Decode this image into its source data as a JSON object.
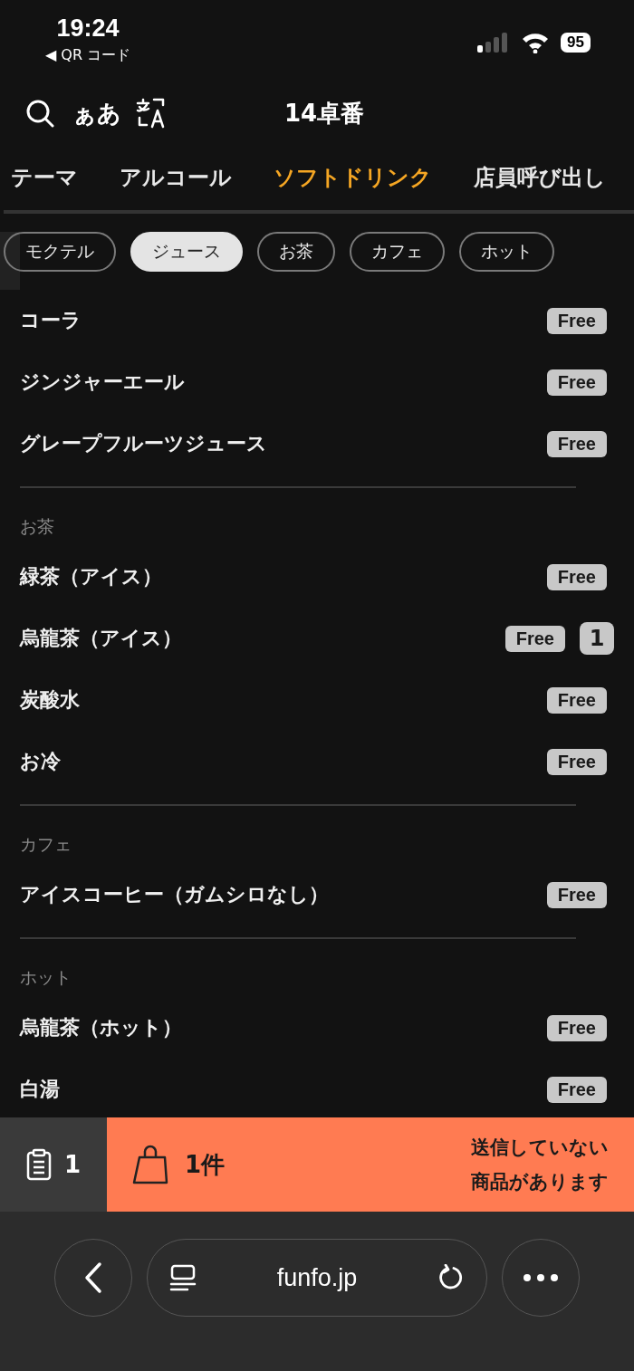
{
  "status_bar": {
    "time": "19:24",
    "back_link": "◀ QR コード",
    "battery": "95"
  },
  "header": {
    "text_size_button": "ぁあ",
    "title": "14卓番"
  },
  "tabs": [
    {
      "label": "テーマ",
      "selected": false
    },
    {
      "label": "アルコール",
      "selected": false
    },
    {
      "label": "ソフトドリンク",
      "selected": true
    },
    {
      "label": "店員呼び出し",
      "selected": false
    }
  ],
  "chips": [
    {
      "label": "モクテル",
      "selected": false
    },
    {
      "label": "ジュース",
      "selected": true
    },
    {
      "label": "お茶",
      "selected": false
    },
    {
      "label": "カフェ",
      "selected": false
    },
    {
      "label": "ホット",
      "selected": false
    }
  ],
  "sections": [
    {
      "items": [
        {
          "name": "コーラ",
          "price": "Free"
        },
        {
          "name": "ジンジャーエール",
          "price": "Free"
        },
        {
          "name": "グレープフルーツジュース",
          "price": "Free"
        }
      ]
    },
    {
      "header": "お茶",
      "items": [
        {
          "name": "緑茶（アイス）",
          "price": "Free"
        },
        {
          "name": "烏龍茶（アイス）",
          "price": "Free",
          "count": "1"
        },
        {
          "name": "炭酸水",
          "price": "Free"
        },
        {
          "name": "お冷",
          "price": "Free"
        }
      ]
    },
    {
      "header": "カフェ",
      "items": [
        {
          "name": "アイスコーヒー（ガムシロなし）",
          "price": "Free"
        }
      ]
    },
    {
      "header": "ホット",
      "items": [
        {
          "name": "烏龍茶（ホット）",
          "price": "Free"
        },
        {
          "name": "白湯",
          "price": "Free"
        }
      ]
    }
  ],
  "bottom_bar": {
    "history_count": "1",
    "cart_count": "1件",
    "notice": [
      "送信していない",
      "商品があります"
    ]
  },
  "browser_bar": {
    "url": "funfo.jp"
  }
}
